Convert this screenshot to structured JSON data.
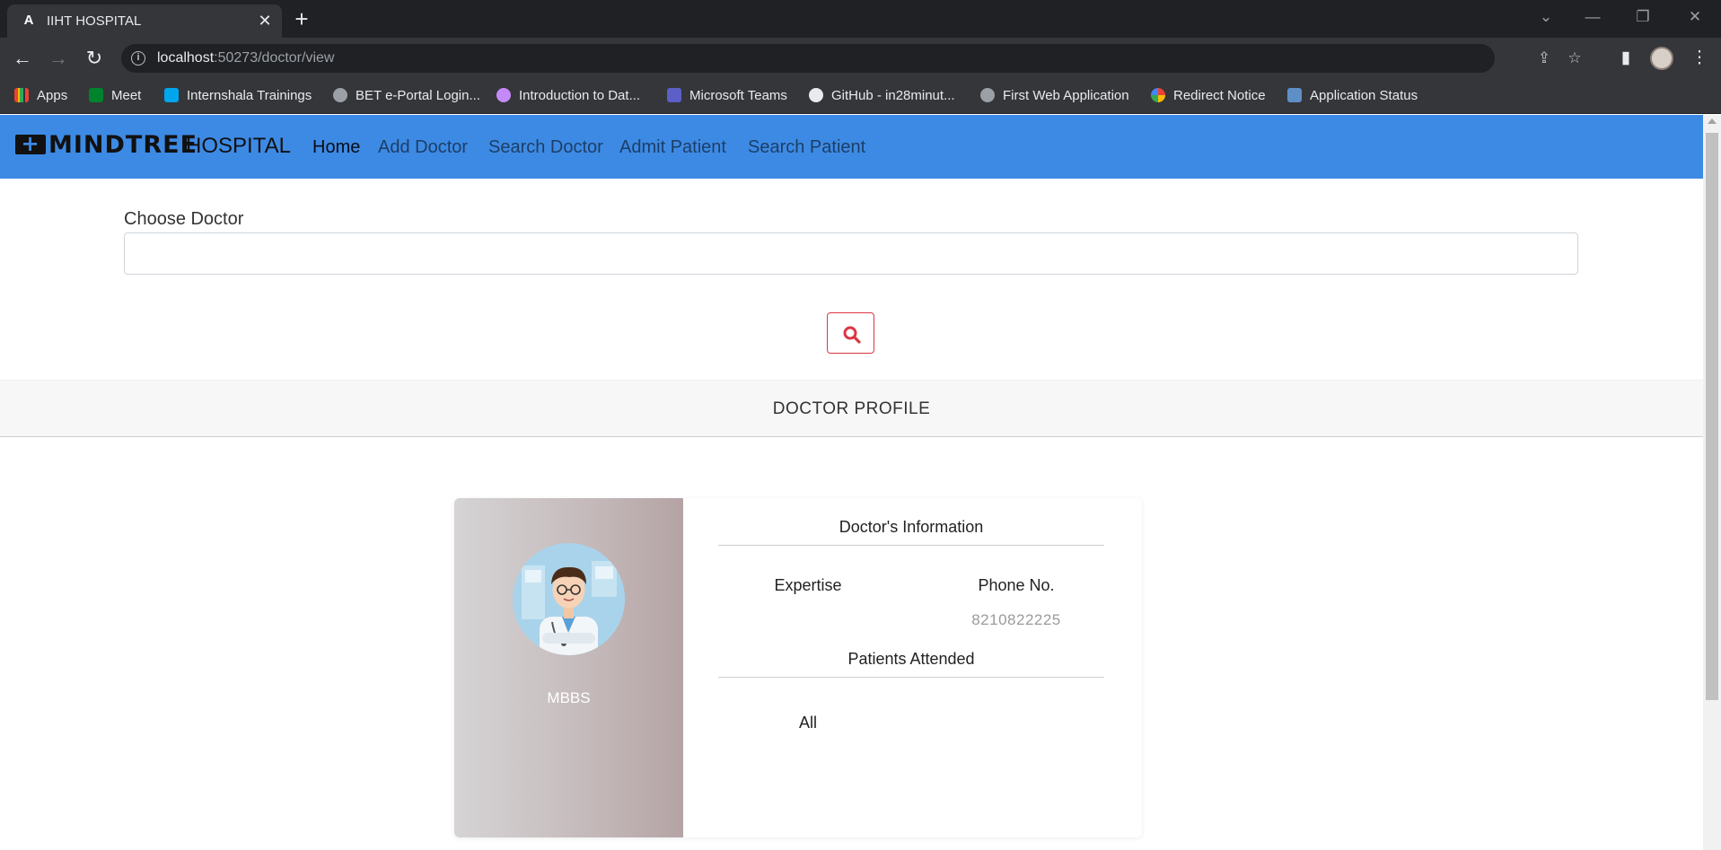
{
  "browser": {
    "tab_title": "IIHT HOSPITAL",
    "url_host": "localhost",
    "url_rest": ":50273/doctor/view",
    "bookmarks": [
      {
        "label": "Apps",
        "icon": "apps-grid-icon"
      },
      {
        "label": "Meet",
        "icon": "meet-icon"
      },
      {
        "label": "Internshala Trainings",
        "icon": "internshala-icon"
      },
      {
        "label": "BET e-Portal Login...",
        "icon": "globe-icon"
      },
      {
        "label": "Introduction to Dat...",
        "icon": "course-icon"
      },
      {
        "label": "Microsoft Teams",
        "icon": "teams-icon"
      },
      {
        "label": "GitHub - in28minut...",
        "icon": "github-icon"
      },
      {
        "label": "First Web Application",
        "icon": "globe-icon"
      },
      {
        "label": "Redirect Notice",
        "icon": "google-icon"
      },
      {
        "label": "Application Status",
        "icon": "application-icon"
      }
    ]
  },
  "navbar": {
    "logo_text": "MINDTREE",
    "brand": "HOSPITAL",
    "links": [
      "Home",
      "Add Doctor",
      "Search Doctor",
      "Admit Patient",
      "Search Patient"
    ],
    "accent": "#3d8ae4"
  },
  "search": {
    "label": "Choose Doctor",
    "value": "",
    "button_icon": "search-icon",
    "button_color": "#dc3545"
  },
  "profile": {
    "section_title": "DOCTOR PROFILE",
    "degree": "MBBS",
    "info_title": "Doctor's Information",
    "expertise_label": "Expertise",
    "expertise_value": "",
    "phone_label": "Phone No.",
    "phone_value": "8210822225",
    "patients_title": "Patients Attended",
    "patients_value": "All"
  }
}
